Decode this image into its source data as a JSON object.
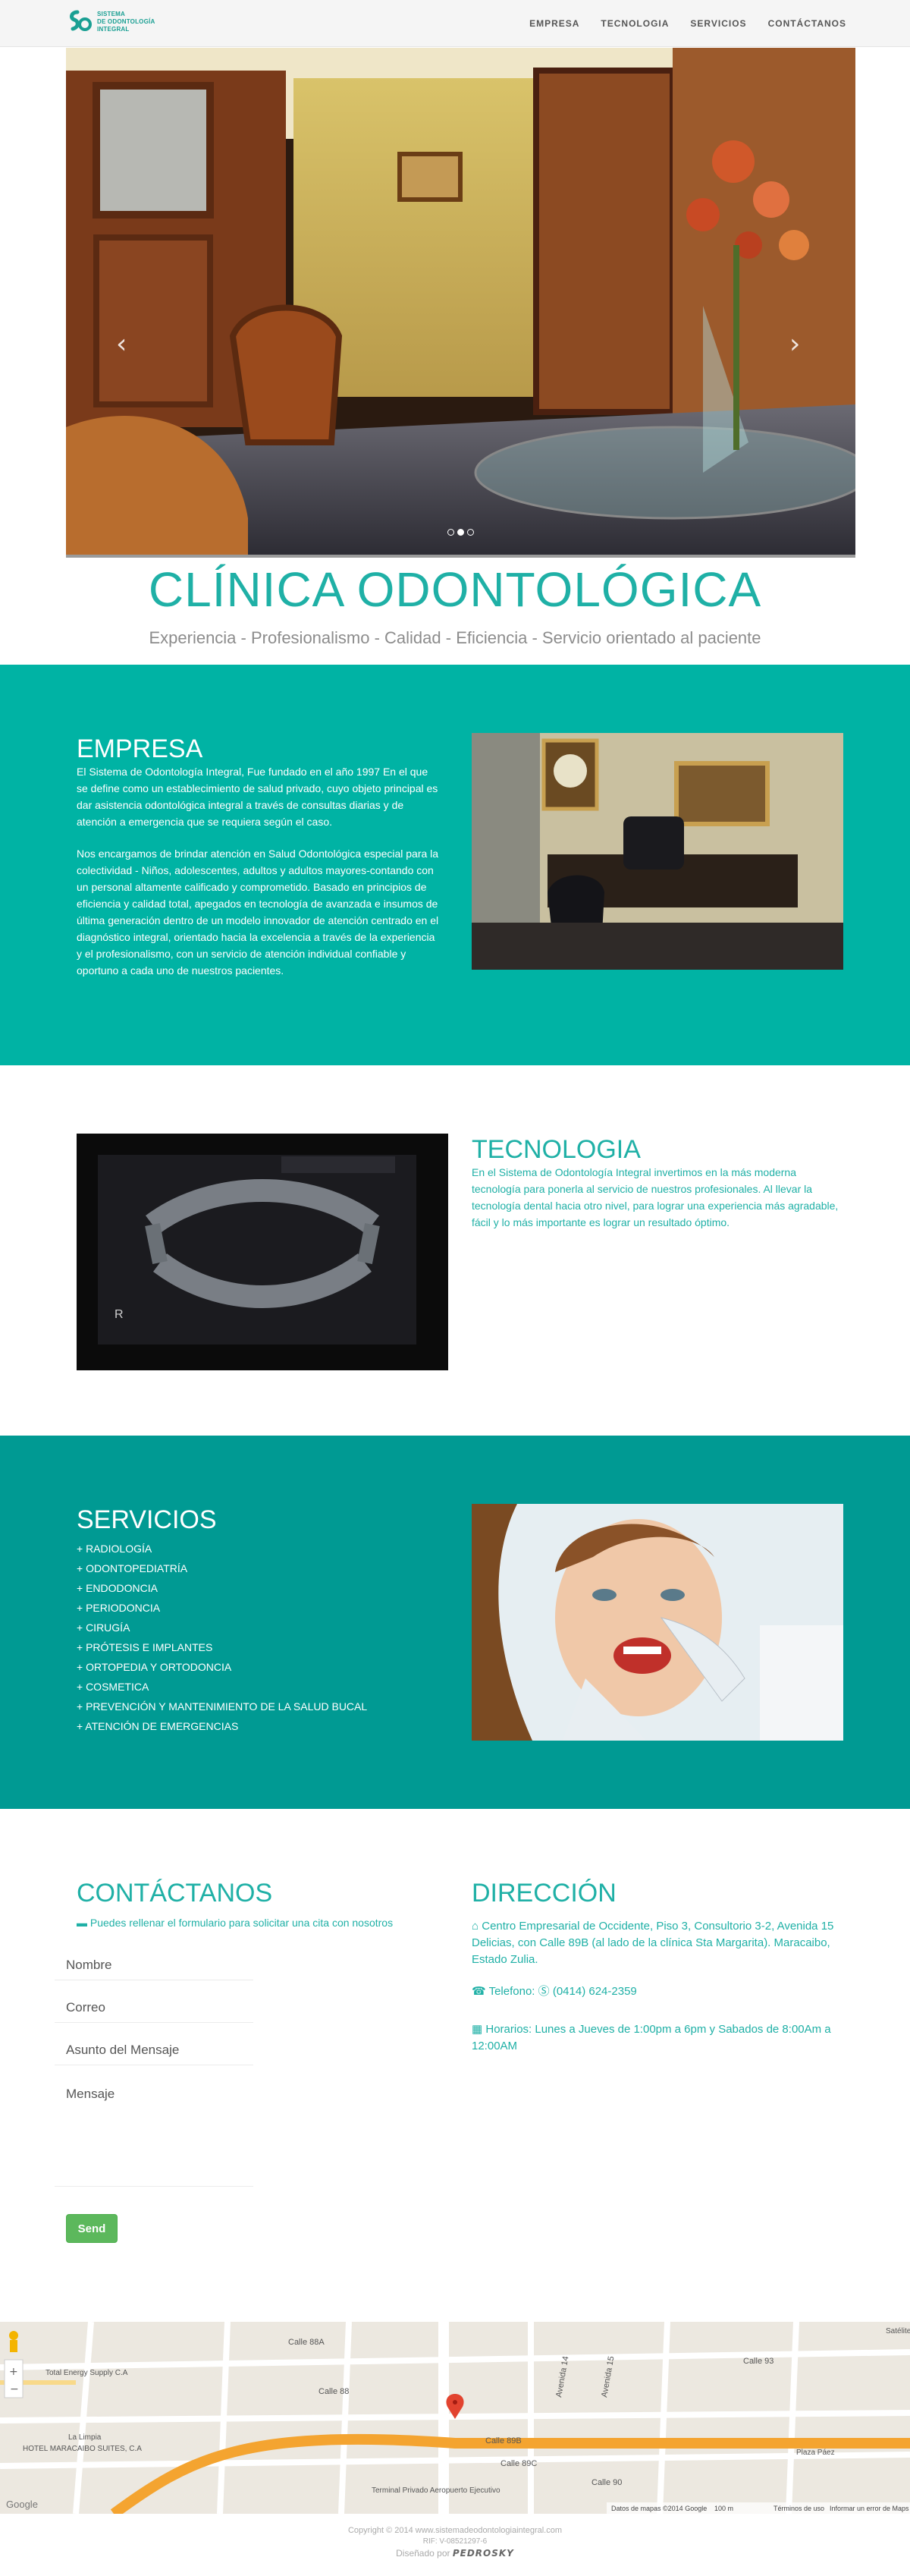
{
  "nav": {
    "logo_lines": [
      "SISTEMA",
      "DE ODONTOLOGÍA",
      "INTEGRAL"
    ],
    "links": [
      "EMPRESA",
      "TECNOLOGIA",
      "SERVICIOS",
      "CONTÁCTANOS"
    ]
  },
  "hero": {
    "title": "CLÍNICA ODONTOLÓGICA",
    "subtitle": "Experiencia - Profesionalismo - Calidad - Eficiencia - Servicio orientado al paciente",
    "slide_count": 3,
    "active_slide": 2
  },
  "empresa": {
    "title": "EMPRESA",
    "paragraph1": "El Sistema de Odontología Integral, Fue fundado en el año 1997 En el que se define como un establecimiento de salud privado, cuyo objeto principal es dar asistencia odontológica integral a través de consultas diarias y de atención a emergencia que se requiera según el caso.",
    "paragraph2": "Nos encargamos de brindar atención en Salud Odontológica especial para la colectividad - Niños, adolescentes, adultos y adultos mayores-contando con un personal altamente calificado y comprometido. Basado en principios de eficiencia y calidad total, apegados en tecnología de avanzada e insumos de última generación dentro de un modelo innovador de atención centrado en el diagnóstico integral, orientado hacia la excelencia a través de la experiencia y el profesionalismo, con un servicio de atención individual confiable y oportuno a cada uno de nuestros pacientes."
  },
  "tecnologia": {
    "title": "TECNOLOGIA",
    "paragraph": "En el Sistema de Odontología Integral invertimos en la más moderna tecnología para ponerla al servicio de nuestros profesionales. Al llevar la tecnología dental hacia otro nivel, para lograr una experiencia más agradable, fácil y lo más importante es lograr un resultado óptimo."
  },
  "servicios": {
    "title": "SERVICIOS",
    "items": [
      "+ RADIOLOGÍA",
      "+ ODONTOPEDIATRÍA",
      "+ ENDODONCIA",
      "+ PERIODONCIA",
      "+ CIRUGÍA",
      "+ PRÓTESIS E IMPLANTES",
      "+ ORTOPEDIA Y ORTODONCIA",
      "+ COSMETICA",
      "+ PREVENCIÓN Y MANTENIMIENTO DE LA SALUD BUCAL",
      "+ ATENCIÓN DE EMERGENCIAS"
    ]
  },
  "contacto": {
    "title": "CONTÁCTANOS",
    "hint": "Puedes rellenar el formulario para solicitar una cita con nosotros",
    "name_placeholder": "Nombre",
    "email_placeholder": "Correo",
    "subject_placeholder": "Asunto del Mensaje",
    "message_placeholder": "Mensaje",
    "send_label": "Send"
  },
  "direccion": {
    "title": "DIRECCIÓN",
    "address": "Centro Empresarial de Occidente, Piso 3, Consultorio 3-2, Avenida 15 Delicias, con Calle 89B (al lado de la clínica Sta Margarita). Maracaibo, Estado Zulia.",
    "phone_label": "Telefono:",
    "phone": "(0414) 624-2359",
    "hours": "Horarios: Lunes a Jueves de 1:00pm a 6pm y Sabados de 8:00Am a 12:00AM"
  },
  "map": {
    "labels": [
      "Calle 88A",
      "Calle 88",
      "Calle 89B",
      "Calle 89C",
      "Calle 90",
      "Calle 93",
      "Avenida 14",
      "Avenida 15",
      "Total Energy Supply C.A",
      "HOTEL MARACAIBO SUITES, C.A",
      "La Limpia",
      "Terminal Privado Aeropuerto Ejecutivo",
      "Plaza Páez",
      "Satélite"
    ],
    "attribution": "Datos de mapas ©2014 Google",
    "scale": "100 m",
    "terms": "Términos de uso",
    "report": "Informar un error de Maps",
    "google": "Google"
  },
  "footer": {
    "copyright": "Copyright © 2014 www.sistemadeodontologiaintegral.com",
    "rif": "RIF: V-08521297-6",
    "designed_by": "Diseñado por",
    "designer": "PEDROSKY"
  },
  "colors": {
    "teal": "#00b3a4",
    "teal_dark": "#009a93",
    "accent": "#1fb0a6",
    "button": "#5cb85c"
  }
}
